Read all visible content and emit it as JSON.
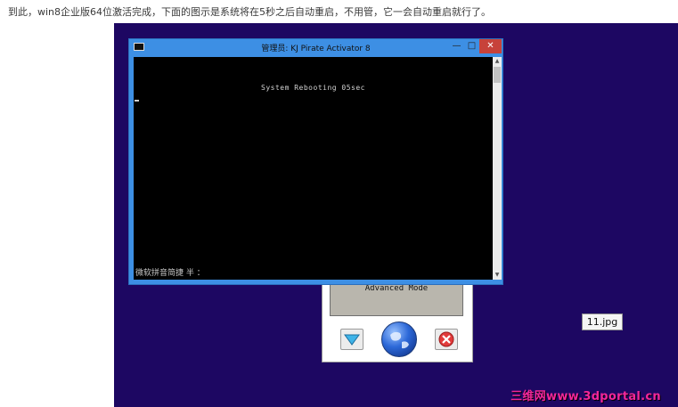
{
  "caption": "到此，win8企业版64位激活完成，下面的图示是系统将在5秒之后自动重启，不用管，它一会自动重启就行了。",
  "console": {
    "title": "管理员:  KJ Pirate Activator 8",
    "icon": "cmd-icon",
    "minimize": "—",
    "maximize": "□",
    "close": "✕",
    "message": "System Rebooting 05sec",
    "ime_status": "微软拼音简捷 半 ："
  },
  "activator": {
    "mode_label": "Advanced Mode",
    "buttons": [
      "down-arrow-icon",
      "globe-icon",
      "close-icon"
    ]
  },
  "file_label": "11.jpg",
  "watermark": "三维网www.3dportal.cn",
  "colors": {
    "desktop": "#1d0762",
    "window_frame": "#3d8fe4",
    "close_button": "#c7423a",
    "watermark": "#f3279a"
  }
}
